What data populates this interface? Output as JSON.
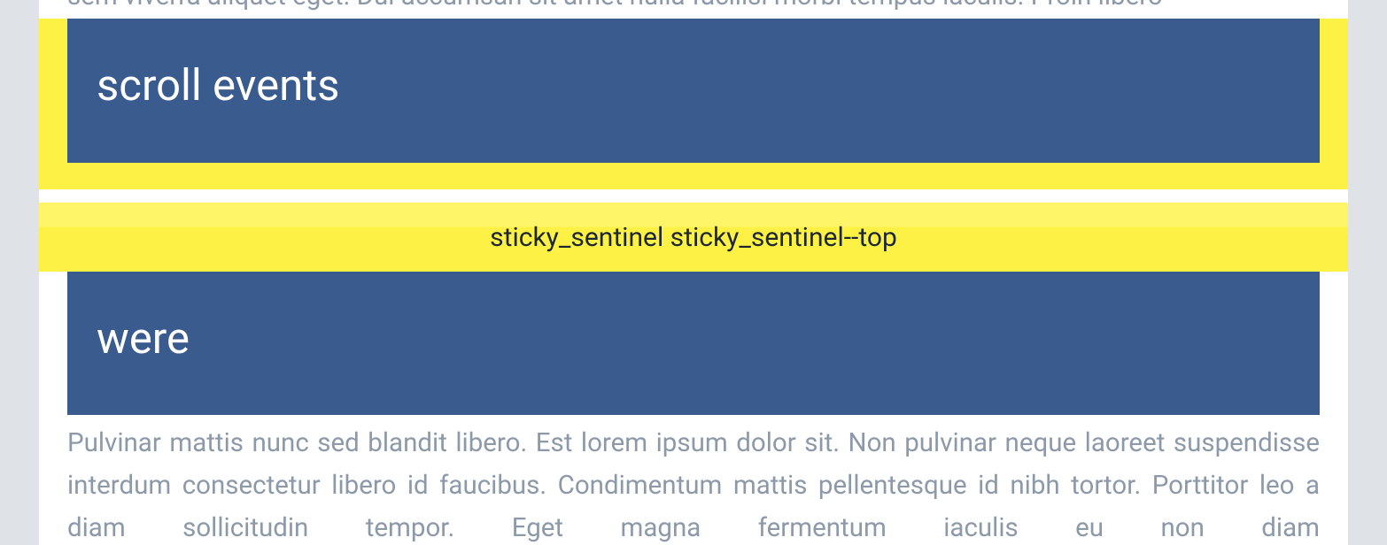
{
  "top_cut_text": "sem viverra aliquet eget. Dui accumsan sit amet nulla facilisi morbi tempus iaculis. Proin libero",
  "header1": {
    "title": "scroll events"
  },
  "sentinel": {
    "label": "sticky_sentinel sticky_sentinel--top"
  },
  "header2": {
    "title": "were"
  },
  "body_paragraph": "Pulvinar mattis nunc sed blandit libero. Est lorem ipsum dolor sit. Non pulvinar neque laoreet suspendisse interdum consectetur libero id faucibus. Condimentum mattis pellentesque id nibh tortor. Porttitor leo a diam sollicitudin tempor. Eget magna fermentum iaculis eu non diam"
}
